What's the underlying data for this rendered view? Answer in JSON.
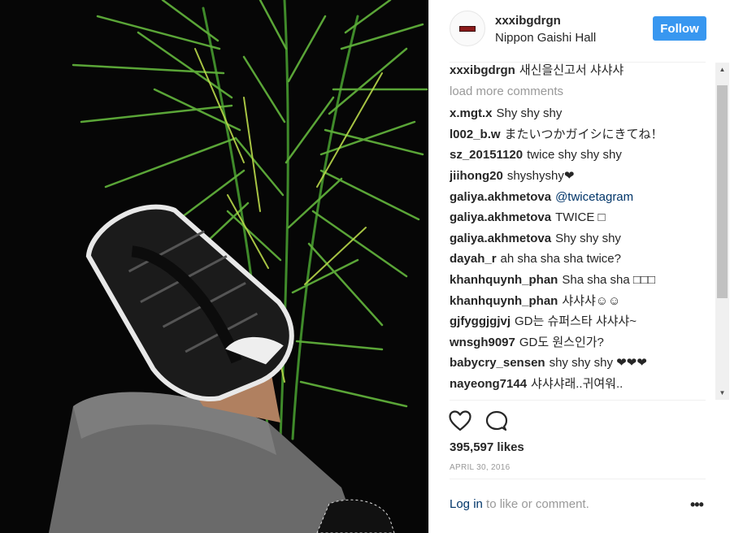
{
  "post": {
    "username": "xxxibgdrgn",
    "location": "Nippon Gaishi Hall",
    "follow_label": "Follow",
    "load_more": "load more comments",
    "likes": "395,597 likes",
    "date": "APRIL 30, 2016",
    "login_link": "Log in",
    "login_rest": " to like or comment.",
    "more_label": "•••"
  },
  "caption": {
    "user": "xxxibgdrgn",
    "text": "새신을신고서 샤샤샤"
  },
  "comments": [
    {
      "user": "x.mgt.x",
      "text": "Shy shy shy"
    },
    {
      "user": "l002_b.w",
      "text": "またいつかガイシにきてね！"
    },
    {
      "user": "sz_20151120",
      "text": "twice shy shy shy"
    },
    {
      "user": "jiihong20",
      "text": "shyshyshy❤"
    },
    {
      "user": "galiya.akhmetova",
      "text": "@twicetagram"
    },
    {
      "user": "galiya.akhmetova",
      "text": "TWICE □"
    },
    {
      "user": "galiya.akhmetova",
      "text": "Shy shy shy"
    },
    {
      "user": "dayah_r",
      "text": "ah sha sha sha twice?"
    },
    {
      "user": "khanhquynh_phan",
      "text": "Sha sha sha □□□"
    },
    {
      "user": "khanhquynh_phan",
      "text": "샤샤샤☺☺"
    },
    {
      "user": "gjfyggjgjvj",
      "text": "GD는 슈퍼스타 샤샤샤~"
    },
    {
      "user": "wnsgh9097",
      "text": "GD도 원스인가?"
    },
    {
      "user": "babycry_sensen",
      "text": "shy shy shy ❤❤❤"
    },
    {
      "user": "nayeong7144",
      "text": "샤샤샤래..귀여워.."
    }
  ],
  "icons": {
    "heart": "heart-outline",
    "comment": "speech-bubble-outline",
    "scroll_up": "▲",
    "scroll_down": "▼"
  },
  "colors": {
    "follow": "#3897f0",
    "link": "#003569",
    "muted": "#999999"
  }
}
